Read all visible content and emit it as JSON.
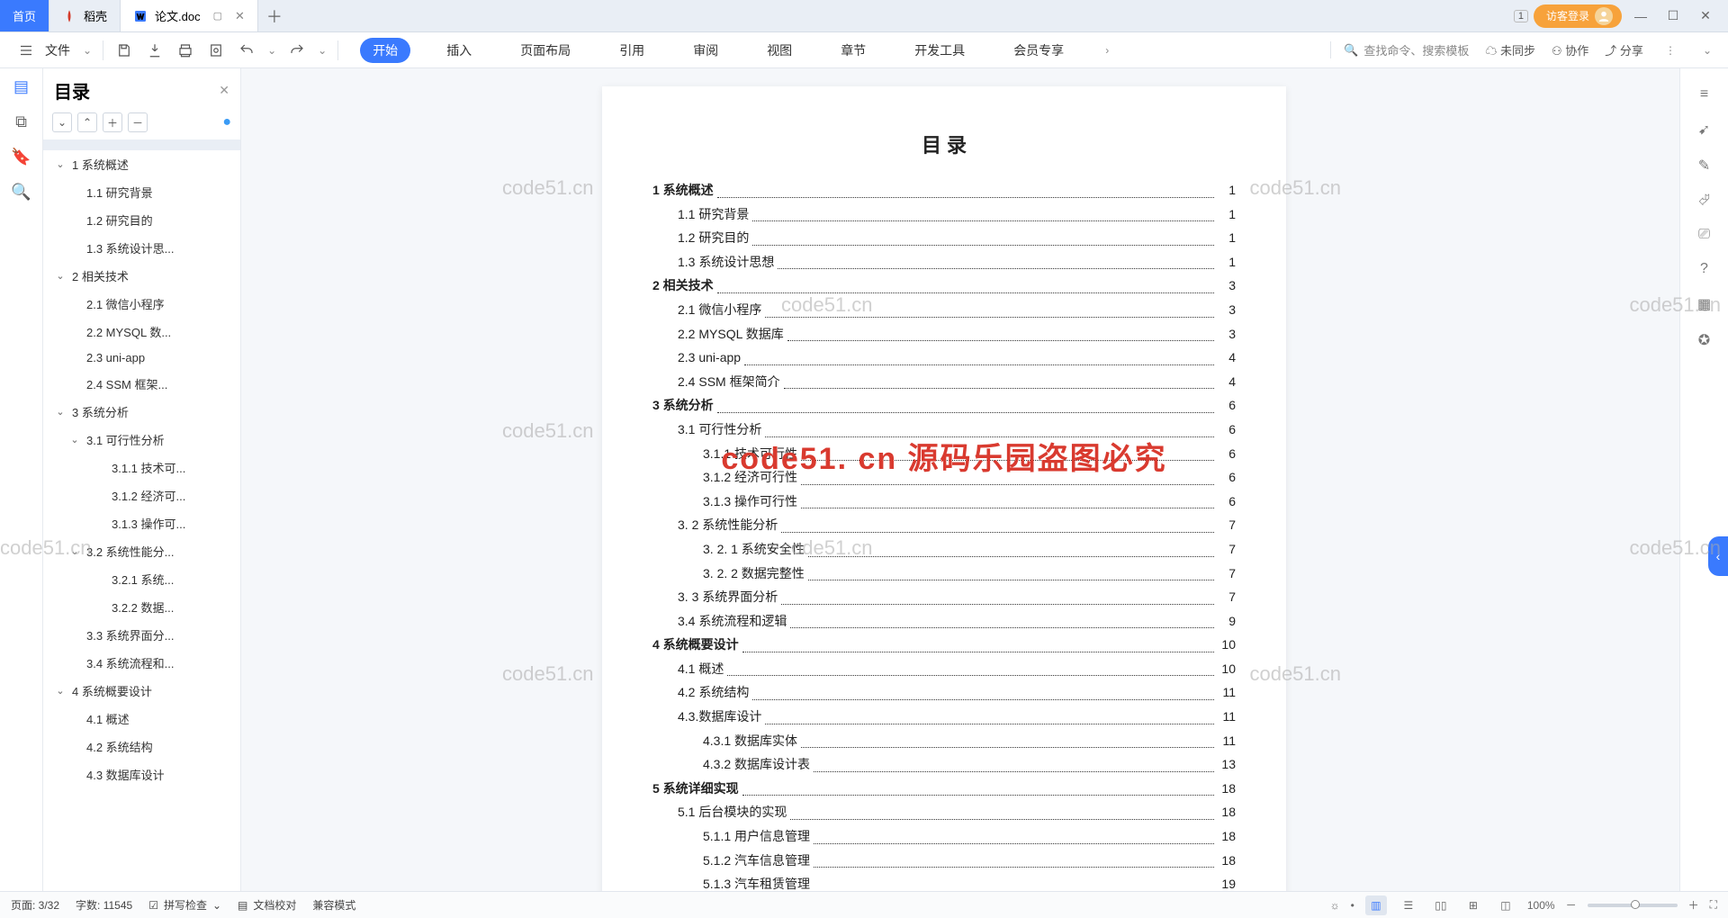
{
  "titlebar": {
    "home": "首页",
    "daoke": "稻壳",
    "docname": "论文.doc",
    "one": "1",
    "login": "访客登录"
  },
  "ribbon": {
    "file": "文件",
    "tabs": [
      "开始",
      "插入",
      "页面布局",
      "引用",
      "审阅",
      "视图",
      "章节",
      "开发工具",
      "会员专享"
    ],
    "search_placeholder": "查找命令、搜索模板",
    "unsync": "未同步",
    "coop": "协作",
    "share": "分享"
  },
  "outline": {
    "title": "目录",
    "items": [
      {
        "lvl": 0,
        "tw": "",
        "txt": "",
        "sel": true
      },
      {
        "lvl": 0,
        "tw": "v",
        "txt": "1 系统概述"
      },
      {
        "lvl": 1,
        "tw": "",
        "txt": "1.1 研究背景"
      },
      {
        "lvl": 1,
        "tw": "",
        "txt": "1.2 研究目的"
      },
      {
        "lvl": 1,
        "tw": "",
        "txt": "1.3 系统设计思..."
      },
      {
        "lvl": 0,
        "tw": "v",
        "txt": "2 相关技术"
      },
      {
        "lvl": 1,
        "tw": "",
        "txt": "2.1 微信小程序"
      },
      {
        "lvl": 1,
        "tw": "",
        "txt": "2.2 MYSQL 数..."
      },
      {
        "lvl": 1,
        "tw": "",
        "txt": "2.3 uni-app"
      },
      {
        "lvl": 1,
        "tw": "",
        "txt": "2.4 SSM 框架..."
      },
      {
        "lvl": 0,
        "tw": "v",
        "txt": "3 系统分析"
      },
      {
        "lvl": 1,
        "tw": "v",
        "txt": "3.1 可行性分析"
      },
      {
        "lvl": 2,
        "tw": "",
        "txt": "3.1.1 技术可..."
      },
      {
        "lvl": 2,
        "tw": "",
        "txt": "3.1.2 经济可..."
      },
      {
        "lvl": 2,
        "tw": "",
        "txt": "3.1.3 操作可..."
      },
      {
        "lvl": 1,
        "tw": "v",
        "txt": "3.2 系统性能分..."
      },
      {
        "lvl": 2,
        "tw": "",
        "txt": "3.2.1 系统..."
      },
      {
        "lvl": 2,
        "tw": "",
        "txt": "3.2.2 数据..."
      },
      {
        "lvl": 1,
        "tw": "",
        "txt": "3.3 系统界面分..."
      },
      {
        "lvl": 1,
        "tw": "",
        "txt": "3.4 系统流程和..."
      },
      {
        "lvl": 0,
        "tw": "v",
        "txt": "4 系统概要设计"
      },
      {
        "lvl": 1,
        "tw": "",
        "txt": "4.1 概述"
      },
      {
        "lvl": 1,
        "tw": "",
        "txt": "4.2 系统结构"
      },
      {
        "lvl": 1,
        "tw": "",
        "txt": "4.3 数据库设计"
      }
    ]
  },
  "doc": {
    "title": "目 录",
    "toc": [
      {
        "lvl": 0,
        "t": "1 系统概述",
        "p": "1"
      },
      {
        "lvl": 1,
        "t": "1.1 研究背景",
        "p": "1"
      },
      {
        "lvl": 1,
        "t": "1.2 研究目的",
        "p": "1"
      },
      {
        "lvl": 1,
        "t": "1.3 系统设计思想",
        "p": "1"
      },
      {
        "lvl": 0,
        "t": "2 相关技术",
        "p": "3"
      },
      {
        "lvl": 1,
        "t": "2.1 微信小程序",
        "p": "3"
      },
      {
        "lvl": 1,
        "t": "2.2 MYSQL 数据库",
        "p": "3"
      },
      {
        "lvl": 1,
        "t": "2.3 uni-app",
        "p": "4"
      },
      {
        "lvl": 1,
        "t": "2.4 SSM 框架简介",
        "p": "4"
      },
      {
        "lvl": 0,
        "t": "3 系统分析",
        "p": "6"
      },
      {
        "lvl": 1,
        "t": "3.1 可行性分析",
        "p": "6"
      },
      {
        "lvl": 2,
        "t": "3.1.1 技术可行性",
        "p": "6"
      },
      {
        "lvl": 2,
        "t": "3.1.2 经济可行性",
        "p": "6"
      },
      {
        "lvl": 2,
        "t": "3.1.3 操作可行性",
        "p": "6"
      },
      {
        "lvl": 1,
        "t": "3. 2 系统性能分析",
        "p": "7"
      },
      {
        "lvl": 2,
        "t": "3. 2. 1  系统安全性",
        "p": "7"
      },
      {
        "lvl": 2,
        "t": "3. 2. 2  数据完整性",
        "p": "7"
      },
      {
        "lvl": 1,
        "t": "3. 3 系统界面分析",
        "p": "7"
      },
      {
        "lvl": 1,
        "t": "3.4 系统流程和逻辑",
        "p": "9"
      },
      {
        "lvl": 0,
        "t": "4 系统概要设计",
        "p": "10"
      },
      {
        "lvl": 1,
        "t": "4.1 概述",
        "p": "10"
      },
      {
        "lvl": 1,
        "t": "4.2 系统结构",
        "p": "11"
      },
      {
        "lvl": 1,
        "t": "4.3.数据库设计",
        "p": "11"
      },
      {
        "lvl": 2,
        "t": "4.3.1 数据库实体",
        "p": "11"
      },
      {
        "lvl": 2,
        "t": "4.3.2 数据库设计表",
        "p": "13"
      },
      {
        "lvl": 0,
        "t": "5 系统详细实现",
        "p": "18"
      },
      {
        "lvl": 1,
        "t": "5.1  后台模块的实现",
        "p": "18"
      },
      {
        "lvl": 2,
        "t": "5.1.1  用户信息管理",
        "p": "18"
      },
      {
        "lvl": 2,
        "t": "5.1.2  汽车信息管理",
        "p": "18"
      },
      {
        "lvl": 2,
        "t": "5.1.3  汽车租赁管理",
        "p": "19"
      }
    ]
  },
  "watermark": {
    "head": "code51. cn 源码乐园盗图必究",
    "small": "code51.cn"
  },
  "status": {
    "page": "页面: 3/32",
    "words": "字数: 11545",
    "spell": "拼写检查",
    "proof": "文档校对",
    "compat": "兼容模式",
    "zoom": "100%"
  }
}
